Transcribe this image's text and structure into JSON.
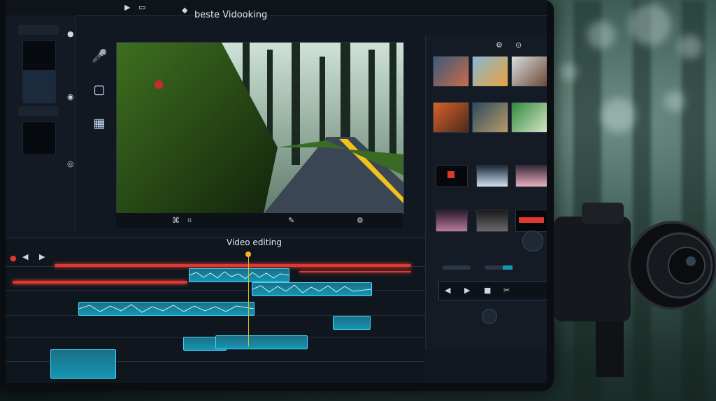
{
  "app": {
    "title": "beste Vidooking"
  },
  "timeline": {
    "title": "Video editing"
  },
  "colors": {
    "accent_red": "#e0372e",
    "clip_cyan": "#1596b3",
    "playhead": "#f5b623"
  },
  "icons": [
    "play-icon",
    "stop-icon",
    "rewind-icon",
    "scissors-icon",
    "search-icon",
    "gear-icon",
    "camera-icon"
  ]
}
